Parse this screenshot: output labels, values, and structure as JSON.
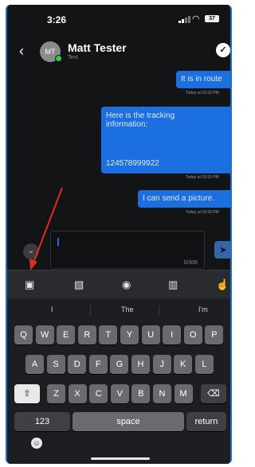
{
  "status": {
    "time": "3:26",
    "battery": "37"
  },
  "header": {
    "avatar_initials": "MT",
    "name": "Matt Tester",
    "subtitle": "Text"
  },
  "messages": [
    {
      "text": "It is in route",
      "time": "Today at 03:20 PM"
    },
    {
      "lines": [
        "Here is the tracking",
        "information:"
      ],
      "number": "124578999922",
      "time": "Today at 03:20 PM"
    },
    {
      "text": "I can send a picture.",
      "time": "Today at 03:20 PM"
    }
  ],
  "composer": {
    "counter": "0/306"
  },
  "keyboard": {
    "suggestions": [
      "I",
      "The",
      "I'm"
    ],
    "row1": [
      "Q",
      "W",
      "E",
      "R",
      "T",
      "Y",
      "U",
      "I",
      "O",
      "P"
    ],
    "row2": [
      "A",
      "S",
      "D",
      "F",
      "G",
      "H",
      "J",
      "K",
      "L"
    ],
    "row3": [
      "Z",
      "X",
      "C",
      "V",
      "B",
      "N",
      "M"
    ],
    "numbers_label": "123",
    "space_label": "space",
    "return_label": "return"
  },
  "icons": {
    "toolbar": [
      "camera-icon",
      "gallery-icon",
      "template-icon",
      "book-icon",
      "gesture-icon"
    ]
  },
  "colors": {
    "accent": "#1b6fe0",
    "background": "#131416",
    "arrow": "#e02b20"
  }
}
